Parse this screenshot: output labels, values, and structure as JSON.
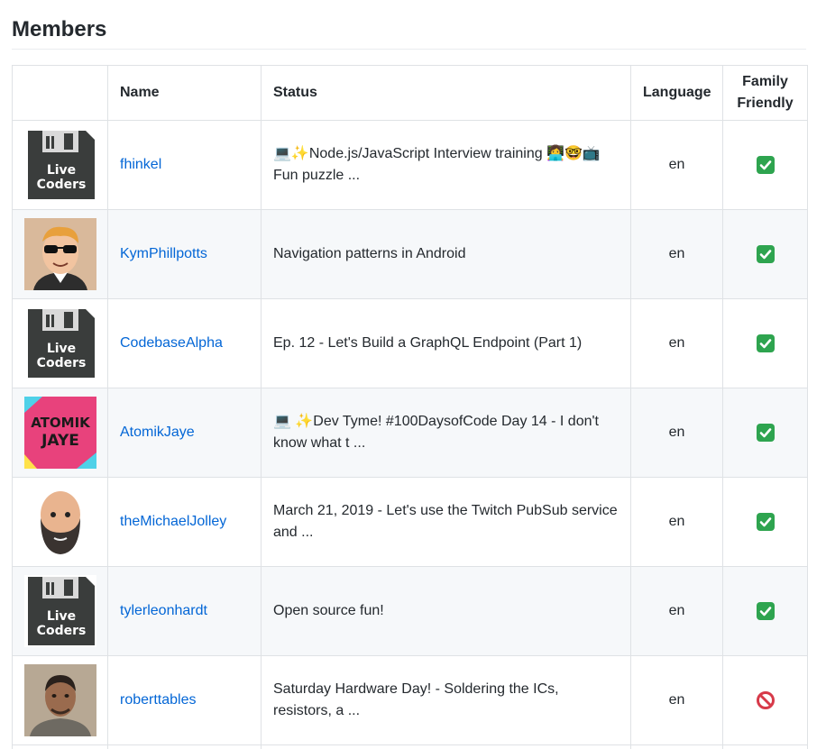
{
  "heading": "Members",
  "columns": [
    "",
    "Name",
    "Status",
    "Language",
    "Family Friendly"
  ],
  "colors": {
    "link": "#0366d6",
    "check": "#2ea44f",
    "blocked": "#d73a49"
  },
  "rows": [
    {
      "name": "fhinkel",
      "status": "💻✨Node.js/JavaScript Interview training 👩‍💻🤓📺Fun puzzle ...",
      "language": "en",
      "family_friendly": "yes",
      "avatar": "live-coders-floppy-avatar"
    },
    {
      "name": "KymPhillpotts",
      "status": "Navigation patterns in Android",
      "language": "en",
      "family_friendly": "yes",
      "avatar": "cartoon-sunglasses-avatar"
    },
    {
      "name": "CodebaseAlpha",
      "status": "Ep. 12 - Let's Build a GraphQL Endpoint (Part 1)",
      "language": "en",
      "family_friendly": "yes",
      "avatar": "live-coders-floppy-avatar"
    },
    {
      "name": "AtomikJaye",
      "status": "💻 ✨Dev Tyme! #100DaysofCode Day 14 - I don't know what t ...",
      "language": "en",
      "family_friendly": "yes",
      "avatar": "atomik-jaye-avatar",
      "avatar_text": [
        "ATOMIK",
        "JAYE"
      ]
    },
    {
      "name": "theMichaelJolley",
      "status": "March 21, 2019 - Let's use the Twitch PubSub service and ...",
      "language": "en",
      "family_friendly": "yes",
      "avatar": "cartoon-bearded-man-avatar"
    },
    {
      "name": "tylerleonhardt",
      "status": "Open source fun!",
      "language": "en",
      "family_friendly": "yes",
      "avatar": "live-coders-floppy-avatar"
    },
    {
      "name": "roberttables",
      "status": "Saturday Hardware Day! - Soldering the ICs, resistors, a ...",
      "language": "en",
      "family_friendly": "no",
      "avatar": "photo-man-avatar"
    }
  ],
  "floppy_text": [
    "Live",
    "Coders"
  ]
}
